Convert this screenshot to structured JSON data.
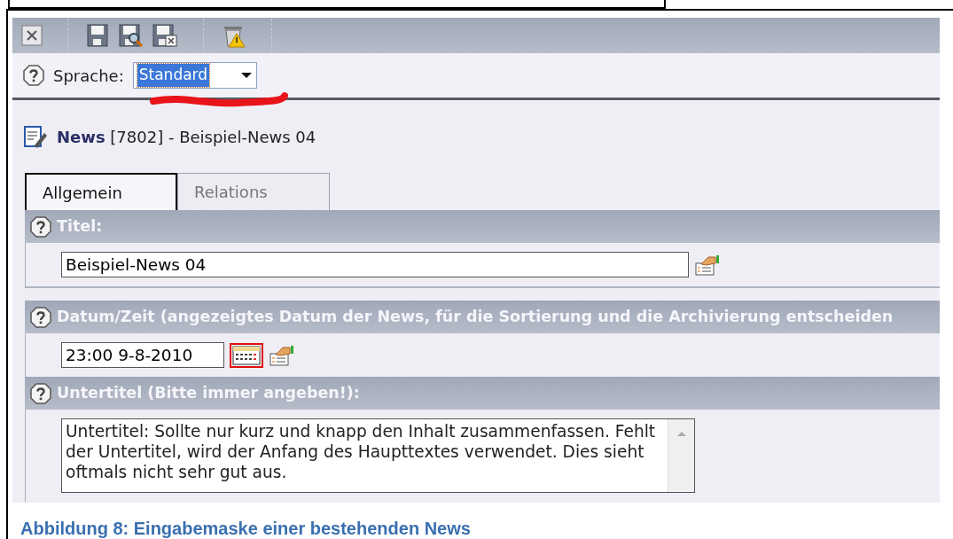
{
  "toolbar": {
    "buttons": [
      {
        "kind": "close"
      },
      {
        "kind": "separator"
      },
      {
        "kind": "save"
      },
      {
        "kind": "save-view"
      },
      {
        "kind": "save-close"
      },
      {
        "kind": "separator"
      },
      {
        "kind": "delete"
      },
      {
        "kind": "separator"
      }
    ]
  },
  "language": {
    "label": "Sprache:",
    "value": "Standard",
    "text_selected": true,
    "underlined": true
  },
  "record": {
    "type": "News",
    "id": "[7802]",
    "title": "- Beispiel-News 04"
  },
  "tabs": [
    {
      "label": "Allgemein",
      "selected": true
    },
    {
      "label": "Relations",
      "selected": false
    }
  ],
  "fields": [
    {
      "kind": "text",
      "label": "Titel:",
      "value": "Beispiel-News 04"
    },
    {
      "kind": "datetime",
      "label": "Datum/Zeit (angezeigtes Datum der News, für die Sortierung und die Archivierung entscheiden",
      "value": "23:00 9-8-2010",
      "calendar_highlighted": true
    },
    {
      "kind": "textarea",
      "label": "Untertitel (Bitte immer angeben!):",
      "value": "Untertitel: Sollte nur kurz und knapp den Inhalt zusammenfassen. Fehlt der Untertitel, wird der Anfang des Haupttextes verwendet. Dies sieht oftmals nicht sehr gut aus."
    }
  ],
  "caption": "Abbildung 8: Eingabemaske einer bestehenden News"
}
